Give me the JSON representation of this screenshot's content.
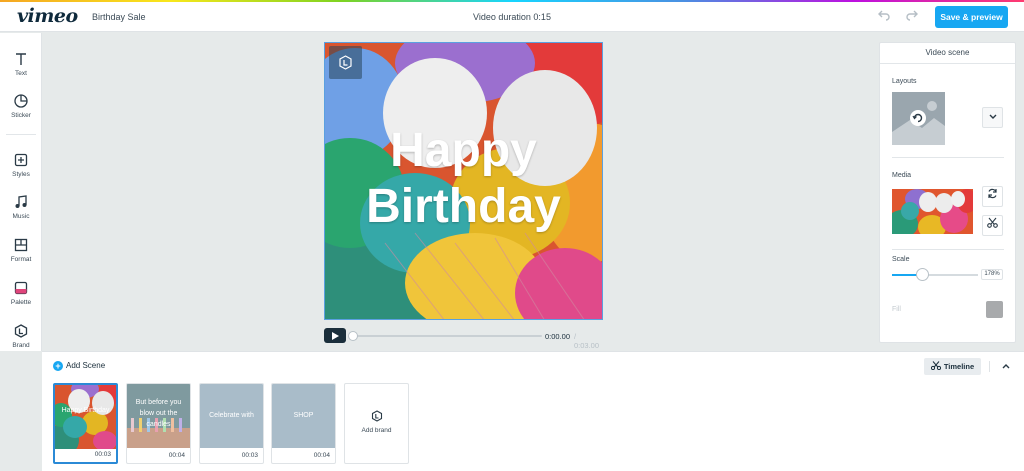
{
  "header": {
    "logo": "vimeo",
    "project_title": "Birthday Sale",
    "duration": "Video duration 0:15",
    "save_label": "Save & preview"
  },
  "sidebar": {
    "items": [
      {
        "label": "Text",
        "icon": "text-icon"
      },
      {
        "label": "Sticker",
        "icon": "sticker-icon"
      },
      {
        "label": "Styles",
        "icon": "styles-icon"
      },
      {
        "label": "Music",
        "icon": "music-icon"
      },
      {
        "label": "Format",
        "icon": "format-icon"
      },
      {
        "label": "Palette",
        "icon": "palette-icon"
      },
      {
        "label": "Brand",
        "icon": "brand-icon"
      }
    ]
  },
  "canvas": {
    "line1": "Happy",
    "line2": "Birthday"
  },
  "player": {
    "current_time": "0:00.00",
    "total_time": "0:03.00"
  },
  "panel": {
    "title": "Video scene",
    "layouts_label": "Layouts",
    "media_label": "Media",
    "scale_label": "Scale",
    "scale_value": "178%",
    "scale_fraction": 0.35,
    "fill_label": "Fill",
    "fill_color": "#a8aaac"
  },
  "bottom": {
    "add_scene": "Add Scene",
    "timeline_label": "Timeline",
    "scenes": [
      {
        "text": "Happy Birthday",
        "duration": "00:03"
      },
      {
        "text": "But before you blow out the candles",
        "duration": "00:04"
      },
      {
        "text": "Celebrate with",
        "duration": "00:03"
      },
      {
        "text": "SHOP",
        "duration": "00:04"
      }
    ],
    "add_brand": "Add brand"
  },
  "colors": {
    "accent": "#17a7f2",
    "dark": "#1a2e3b",
    "scene_placeholder": "#a9bcc9"
  }
}
